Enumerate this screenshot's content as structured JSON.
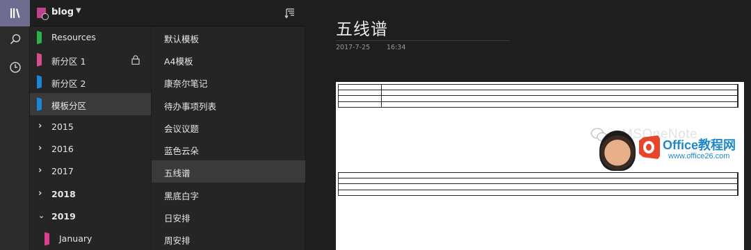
{
  "notebook": {
    "title": "blog"
  },
  "sections": [
    {
      "label": "Resources",
      "color": "#2db24c",
      "type": "section"
    },
    {
      "label": "新分区 1",
      "color": "#d64c8c",
      "type": "section",
      "locked": true
    },
    {
      "label": "新分区 2",
      "color": "#1c86d6",
      "type": "section"
    },
    {
      "label": "模板分区",
      "color": "#1c86d6",
      "type": "section",
      "selected": true
    },
    {
      "label": "2015",
      "type": "group",
      "expanded": false
    },
    {
      "label": "2016",
      "type": "group",
      "expanded": false
    },
    {
      "label": "2017",
      "type": "group",
      "expanded": false
    },
    {
      "label": "2018",
      "type": "group",
      "expanded": false
    },
    {
      "label": "2019",
      "type": "group",
      "expanded": true
    },
    {
      "label": "January",
      "color": "#e03d8f",
      "type": "section",
      "indent": true
    }
  ],
  "pages": [
    {
      "label": "默认模板"
    },
    {
      "label": "A4模板"
    },
    {
      "label": "康奈尔笔记"
    },
    {
      "label": "待办事项列表"
    },
    {
      "label": "会议议题"
    },
    {
      "label": "蓝色云朵"
    },
    {
      "label": "五线谱",
      "selected": true
    },
    {
      "label": "黑底白字"
    },
    {
      "label": "日安排"
    },
    {
      "label": "周安排"
    }
  ],
  "page": {
    "title": "五线谱",
    "date": "2017-7-25",
    "time": "16:34"
  },
  "watermark": {
    "text": "MSOneNote",
    "brand": "Office教程网",
    "url": "www.office26.com"
  },
  "colors": {
    "rail_active": "#6f6c92",
    "selected_row": "#3a3a3a",
    "background": "#1e1e1e"
  }
}
